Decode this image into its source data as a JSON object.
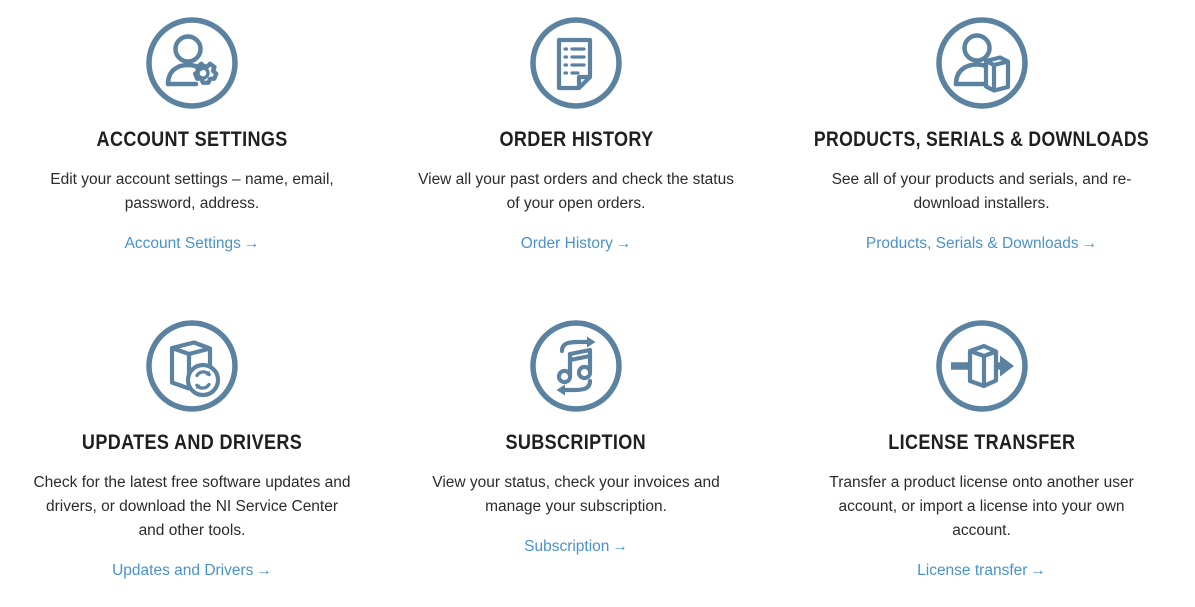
{
  "theme": {
    "icon_color": "#5b82a0",
    "title_color": "#1f1f21",
    "body_color": "#2b2b2d",
    "link_color": "#4a92c9",
    "background": "#ffffff"
  },
  "cards": [
    {
      "icon": "user-gear-icon",
      "title": "ACCOUNT SETTINGS",
      "description": "Edit your account settings – name, email, password, address.",
      "link_label": "Account Settings",
      "link_arrow": "→"
    },
    {
      "icon": "document-list-icon",
      "title": "ORDER HISTORY",
      "description": "View all your past orders and check the status of your open orders.",
      "link_label": "Order History",
      "link_arrow": "→"
    },
    {
      "icon": "user-product-box-icon",
      "title": "PRODUCTS, SERIALS & DOWNLOADS",
      "description": "See all of your products and serials, and re-download installers.",
      "link_label": "Products, Serials & Downloads",
      "link_arrow": "→"
    },
    {
      "icon": "product-box-refresh-icon",
      "title": "UPDATES AND DRIVERS",
      "description": "Check for the latest free software updates and drivers, or download the NI Service Center and other tools.",
      "link_label": "Updates and Drivers",
      "link_arrow": "→"
    },
    {
      "icon": "music-note-recurring-icon",
      "title": "SUBSCRIPTION",
      "description": "View your status, check your invoices and manage your subscription.",
      "link_label": "Subscription",
      "link_arrow": "→"
    },
    {
      "icon": "license-transfer-arrow-icon",
      "title": "LICENSE TRANSFER",
      "description": "Transfer a product license onto another user account, or import a license into your own account.",
      "link_label": "License transfer",
      "link_arrow": "→"
    }
  ]
}
